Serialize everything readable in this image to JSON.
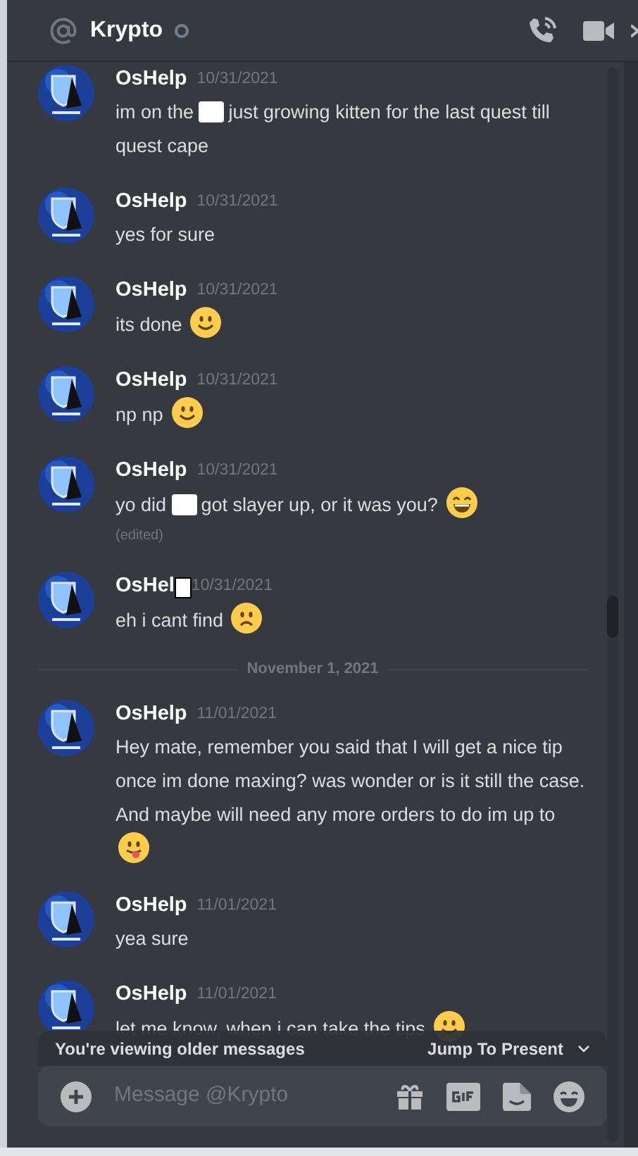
{
  "header": {
    "title": "Krypto",
    "online": false
  },
  "messages": [
    {
      "author": "OsHelp",
      "author_redacted": false,
      "time": "10/31/2021",
      "edited": false,
      "content": [
        {
          "kind": "text",
          "text": "im on the"
        },
        {
          "kind": "redacted"
        },
        {
          "kind": "text",
          "text": "just growing kitten for the last quest till quest cape"
        }
      ]
    },
    {
      "author": "OsHelp",
      "author_redacted": false,
      "time": "10/31/2021",
      "edited": false,
      "content": [
        {
          "kind": "text",
          "text": "yes for sure"
        }
      ]
    },
    {
      "author": "OsHelp",
      "author_redacted": false,
      "time": "10/31/2021",
      "edited": false,
      "content": [
        {
          "kind": "text",
          "text": "its done"
        },
        {
          "kind": "smile"
        }
      ]
    },
    {
      "author": "OsHelp",
      "author_redacted": false,
      "time": "10/31/2021",
      "edited": false,
      "content": [
        {
          "kind": "text",
          "text": "np np"
        },
        {
          "kind": "smile"
        }
      ]
    },
    {
      "author": "OsHelp",
      "author_redacted": false,
      "time": "10/31/2021",
      "edited": true,
      "edited_label": "(edited)",
      "content": [
        {
          "kind": "text",
          "text": "yo did"
        },
        {
          "kind": "redacted"
        },
        {
          "kind": "text",
          "text": "got slayer up, or it was you?"
        },
        {
          "kind": "grin"
        }
      ]
    },
    {
      "author": "OsHel",
      "author_redacted": true,
      "time": "10/31/2021",
      "edited": false,
      "content": [
        {
          "kind": "text",
          "text": "eh i cant find"
        },
        {
          "kind": "frown"
        }
      ]
    },
    {
      "kind": "divider",
      "label": "November 1, 2021"
    },
    {
      "author": "OsHelp",
      "author_redacted": false,
      "time": "11/01/2021",
      "edited": false,
      "content": [
        {
          "kind": "text",
          "text": "Hey mate, remember you said that I will get a nice tip once im done maxing? was wonder or is it still the case. And maybe will need any more orders to do im up to"
        },
        {
          "kind": "tongue"
        }
      ]
    },
    {
      "author": "OsHelp",
      "author_redacted": false,
      "time": "11/01/2021",
      "edited": false,
      "content": [
        {
          "kind": "text",
          "text": "yea sure"
        }
      ]
    },
    {
      "author": "OsHelp",
      "author_redacted": false,
      "time": "11/01/2021",
      "edited": false,
      "content": [
        {
          "kind": "text",
          "text": "let me know, when i can take the tips"
        },
        {
          "kind": "smile"
        }
      ]
    }
  ],
  "older_bar": {
    "notice": "You're viewing older messages",
    "jump": "Jump To Present"
  },
  "composer": {
    "placeholder": "Message @Krypto"
  }
}
